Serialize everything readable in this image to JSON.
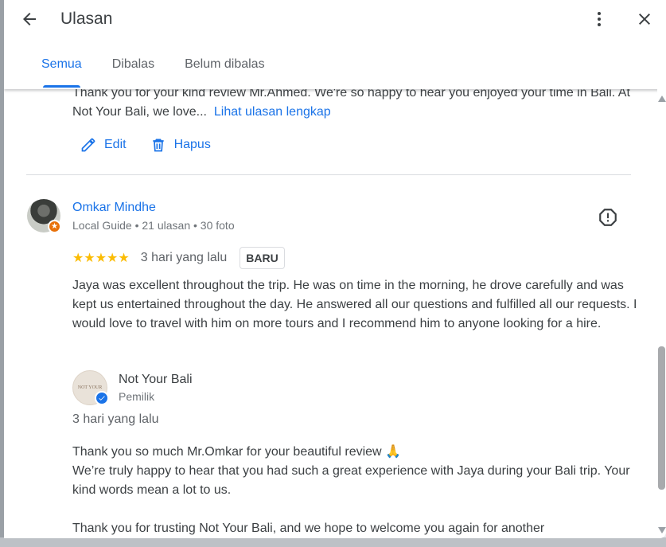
{
  "header": {
    "title": "Ulasan",
    "tabs": [
      {
        "label": "Semua",
        "active": true
      },
      {
        "label": "Dibalas",
        "active": false
      },
      {
        "label": "Belum dibalas",
        "active": false
      }
    ]
  },
  "previous_reply": {
    "text": "Thank you for your kind review Mr.Ahmed. We're so happy to hear you enjoyed your time in Bali. At Not Your Bali, we love...",
    "more_link": "Lihat ulasan lengkap",
    "edit_label": "Edit",
    "delete_label": "Hapus"
  },
  "review": {
    "author": "Omkar Mindhe",
    "meta": "Local Guide • 21 ulasan • 30 foto",
    "stars": "★★★★★",
    "rating": 5,
    "date": "3 hari yang lalu",
    "badge": "BARU",
    "text": "Jaya was excellent throughout the trip. He was on time in the morning, he drove carefully and was kept us entertained throughout the day. He answered all our questions and fulfilled all our requests. I would love to travel with him on more tours and I recommend him to anyone looking for a hire."
  },
  "owner_reply": {
    "name": "Not Your Bali",
    "role": "Pemilik",
    "logo_text": "NOT YOUR",
    "date": "3 hari yang lalu",
    "line1": "Thank you so much Mr.Omkar for your beautiful review 🙏",
    "line2": "We’re truly happy to hear that you had such a great experience with Jaya during your Bali trip. Your kind words mean a lot to us.",
    "line3": "Thank you for trusting Not Your Bali, and we hope to welcome you again for another"
  },
  "colors": {
    "accent": "#1a73e8",
    "star": "#fbbc04",
    "guide_badge": "#e8710a"
  }
}
